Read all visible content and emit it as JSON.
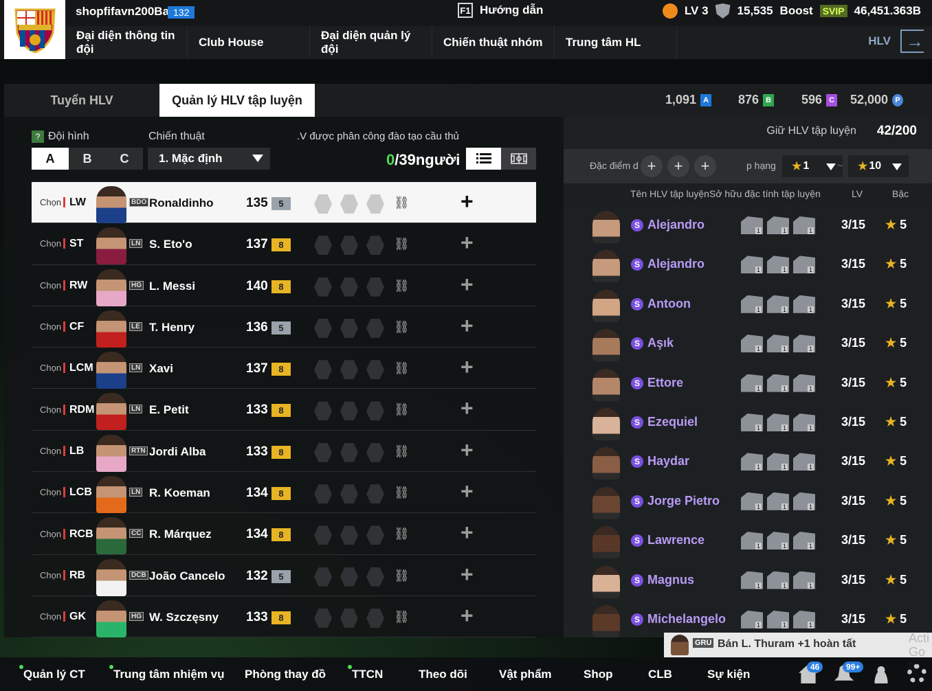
{
  "header": {
    "team_name": "shopfifavn200Ba",
    "team_badge": "132",
    "guide_key": "F1",
    "guide_label": "Hướng dẫn",
    "level": "LV 3",
    "points": "15,535",
    "boost_label": "Boost",
    "svip_label": "SVIP",
    "balance": "46,451.363B"
  },
  "nav": {
    "items": [
      "Đại diện thông tin đội",
      "Club House",
      "Đại diện quản lý đội",
      "Chiến thuật nhóm",
      "Trung tâm HL"
    ],
    "right_label": "HLV"
  },
  "tabs": [
    "Tuyển HLV",
    "Quản lý HLV tập luyện"
  ],
  "currencies": [
    {
      "value": "1,091",
      "chip": "A",
      "color": "#1e78d8"
    },
    {
      "value": "876",
      "chip": "B",
      "color": "#2fa84f"
    },
    {
      "value": "596",
      "chip": "C",
      "color": "#a44fe0"
    },
    {
      "value": "52,000",
      "chip": "P",
      "color": "#4a86d8"
    }
  ],
  "left": {
    "squad_label": "Đội hình",
    "squad_options": [
      "A",
      "B",
      "C"
    ],
    "tactic_label": "Chiến thuật",
    "tactic_value": "1. Mặc định",
    "assigned_label": ".V được phân công đào tạo cầu thủ",
    "assigned_count": "0",
    "assigned_total": "/39người",
    "chon_label": "Chọn"
  },
  "players": [
    {
      "pos": "LW",
      "season": "BDO",
      "name": "Ronaldinho",
      "ovr": "135",
      "upg": "5",
      "upg_color": "silver",
      "selected": true
    },
    {
      "pos": "ST",
      "season": "LN",
      "name": "S. Eto'o",
      "ovr": "137",
      "upg": "8",
      "upg_color": "gold"
    },
    {
      "pos": "RW",
      "season": "HG",
      "name": "L. Messi",
      "ovr": "140",
      "upg": "8",
      "upg_color": "gold"
    },
    {
      "pos": "CF",
      "season": "LE",
      "name": "T. Henry",
      "ovr": "136",
      "upg": "5",
      "upg_color": "silver"
    },
    {
      "pos": "LCM",
      "season": "LN",
      "name": "Xavi",
      "ovr": "137",
      "upg": "8",
      "upg_color": "gold"
    },
    {
      "pos": "RDM",
      "season": "LN",
      "name": "E. Petit",
      "ovr": "133",
      "upg": "8",
      "upg_color": "gold"
    },
    {
      "pos": "LB",
      "season": "RTN",
      "name": "Jordi Alba",
      "ovr": "133",
      "upg": "8",
      "upg_color": "gold"
    },
    {
      "pos": "LCB",
      "season": "LN",
      "name": "R. Koeman",
      "ovr": "134",
      "upg": "8",
      "upg_color": "gold"
    },
    {
      "pos": "RCB",
      "season": "CC",
      "name": "R. Márquez",
      "ovr": "134",
      "upg": "8",
      "upg_color": "gold"
    },
    {
      "pos": "RB",
      "season": "DCB",
      "name": "João Cancelo",
      "ovr": "132",
      "upg": "5",
      "upg_color": "silver"
    },
    {
      "pos": "GK",
      "season": "HG",
      "name": "W. Szczęsny",
      "ovr": "133",
      "upg": "8",
      "upg_color": "gold"
    }
  ],
  "right": {
    "limit_label": "Giữ HLV tập luyện",
    "limit_value": "42/200",
    "filter_trait_label": "Đặc điểm d",
    "filter_rank_label": "p hạng",
    "star_from": "1",
    "star_to": "10",
    "col_name": "Tên HLV tập luyện",
    "col_traits": "Sở hữu đặc tính tập luyện",
    "col_lv": "LV",
    "col_rank": "Bậc"
  },
  "coaches": [
    {
      "name": "Alejandro",
      "lv": "3/15",
      "rank": "5"
    },
    {
      "name": "Alejandro",
      "lv": "3/15",
      "rank": "5"
    },
    {
      "name": "Antoon",
      "lv": "3/15",
      "rank": "5"
    },
    {
      "name": "Aşık",
      "lv": "3/15",
      "rank": "5"
    },
    {
      "name": "Ettore",
      "lv": "3/15",
      "rank": "5"
    },
    {
      "name": "Ezequiel",
      "lv": "3/15",
      "rank": "5"
    },
    {
      "name": "Haydar",
      "lv": "3/15",
      "rank": "5"
    },
    {
      "name": "Jorge Pietro",
      "lv": "3/15",
      "rank": "5"
    },
    {
      "name": "Lawrence",
      "lv": "3/15",
      "rank": "5"
    },
    {
      "name": "Magnus",
      "lv": "3/15",
      "rank": "5"
    },
    {
      "name": "Michelangelo",
      "lv": "3/15",
      "rank": "5"
    }
  ],
  "toast": {
    "tag": "GRU",
    "text": "Bán L. Thuram +1 hoàn tất",
    "ghost": "Acti Go to"
  },
  "bottom_nav": {
    "items": [
      "Quản lý CT",
      "Trung tâm nhiệm vụ",
      "Phòng thay đồ",
      "TTCN",
      "Theo dõi",
      "Vật phẩm",
      "Shop",
      "CLB",
      "Sự kiện"
    ],
    "home_badge": "46",
    "bell_badge": "99+"
  }
}
